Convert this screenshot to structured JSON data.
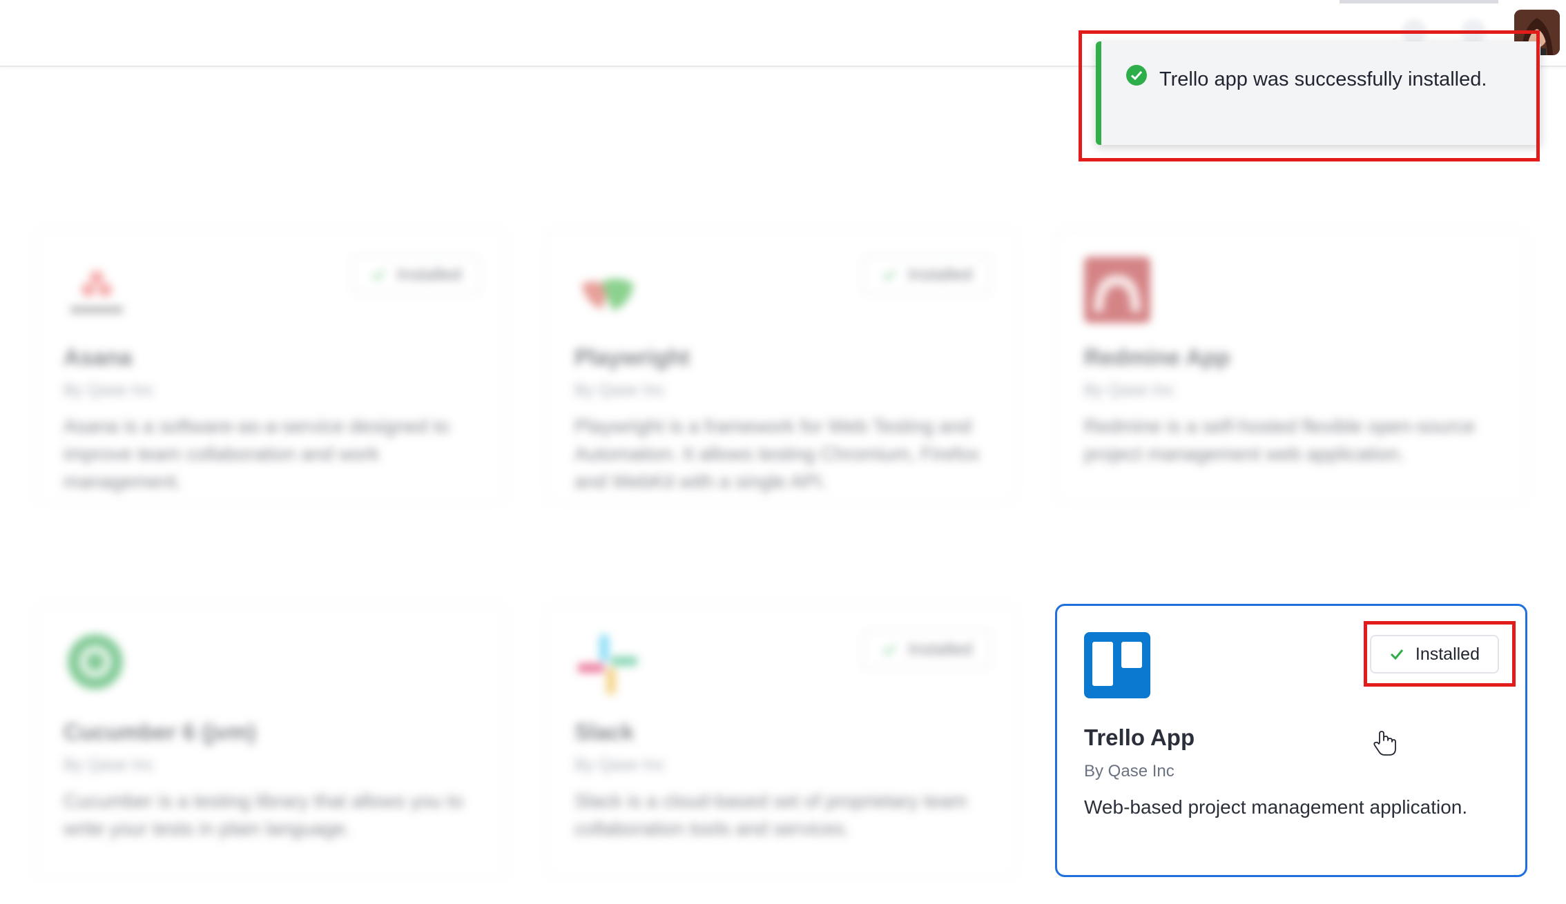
{
  "toast": {
    "message": "Trello app was successfully installed.",
    "status_color": "#31b04a"
  },
  "apps": [
    {
      "name": "Asana",
      "vendor": "By Qase Inc",
      "description": "Asana is a software-as-a-service designed to improve team collaboration and work management.",
      "installed_label": "Installed",
      "icon": "asana-logo-icon"
    },
    {
      "name": "Playwright",
      "vendor": "By Qase Inc",
      "description": "Playwright is a framework for Web Testing and Automation. It allows testing Chromium, Firefox and WebKit with a single API.",
      "installed_label": "Installed",
      "icon": "playwright-logo-icon"
    },
    {
      "name": "Redmine App",
      "vendor": "By Qase Inc",
      "description": "Redmine is a self-hosted flexible open-source project management web application.",
      "icon": "redmine-logo-icon"
    },
    {
      "name": "Cucumber 6 (jvm)",
      "vendor": "By Qase Inc",
      "description": "Cucumber is a testing library that allows you to write your tests in plain language.",
      "icon": "cucumber-logo-icon"
    },
    {
      "name": "Slack",
      "vendor": "By Qase Inc",
      "description": "Slack is a cloud-based set of proprietary team collaboration tools and services.",
      "installed_label": "Installed",
      "icon": "slack-logo-icon"
    },
    {
      "name": "Trello App",
      "vendor": "By Qase Inc",
      "description": "Web-based project management application.",
      "installed_label": "Installed",
      "icon": "trello-logo-icon"
    }
  ],
  "colors": {
    "accent_blue": "#1f6fde",
    "highlight_red": "#e21b1b",
    "success_green": "#2eae4a",
    "trello_blue": "#0b79d0"
  }
}
